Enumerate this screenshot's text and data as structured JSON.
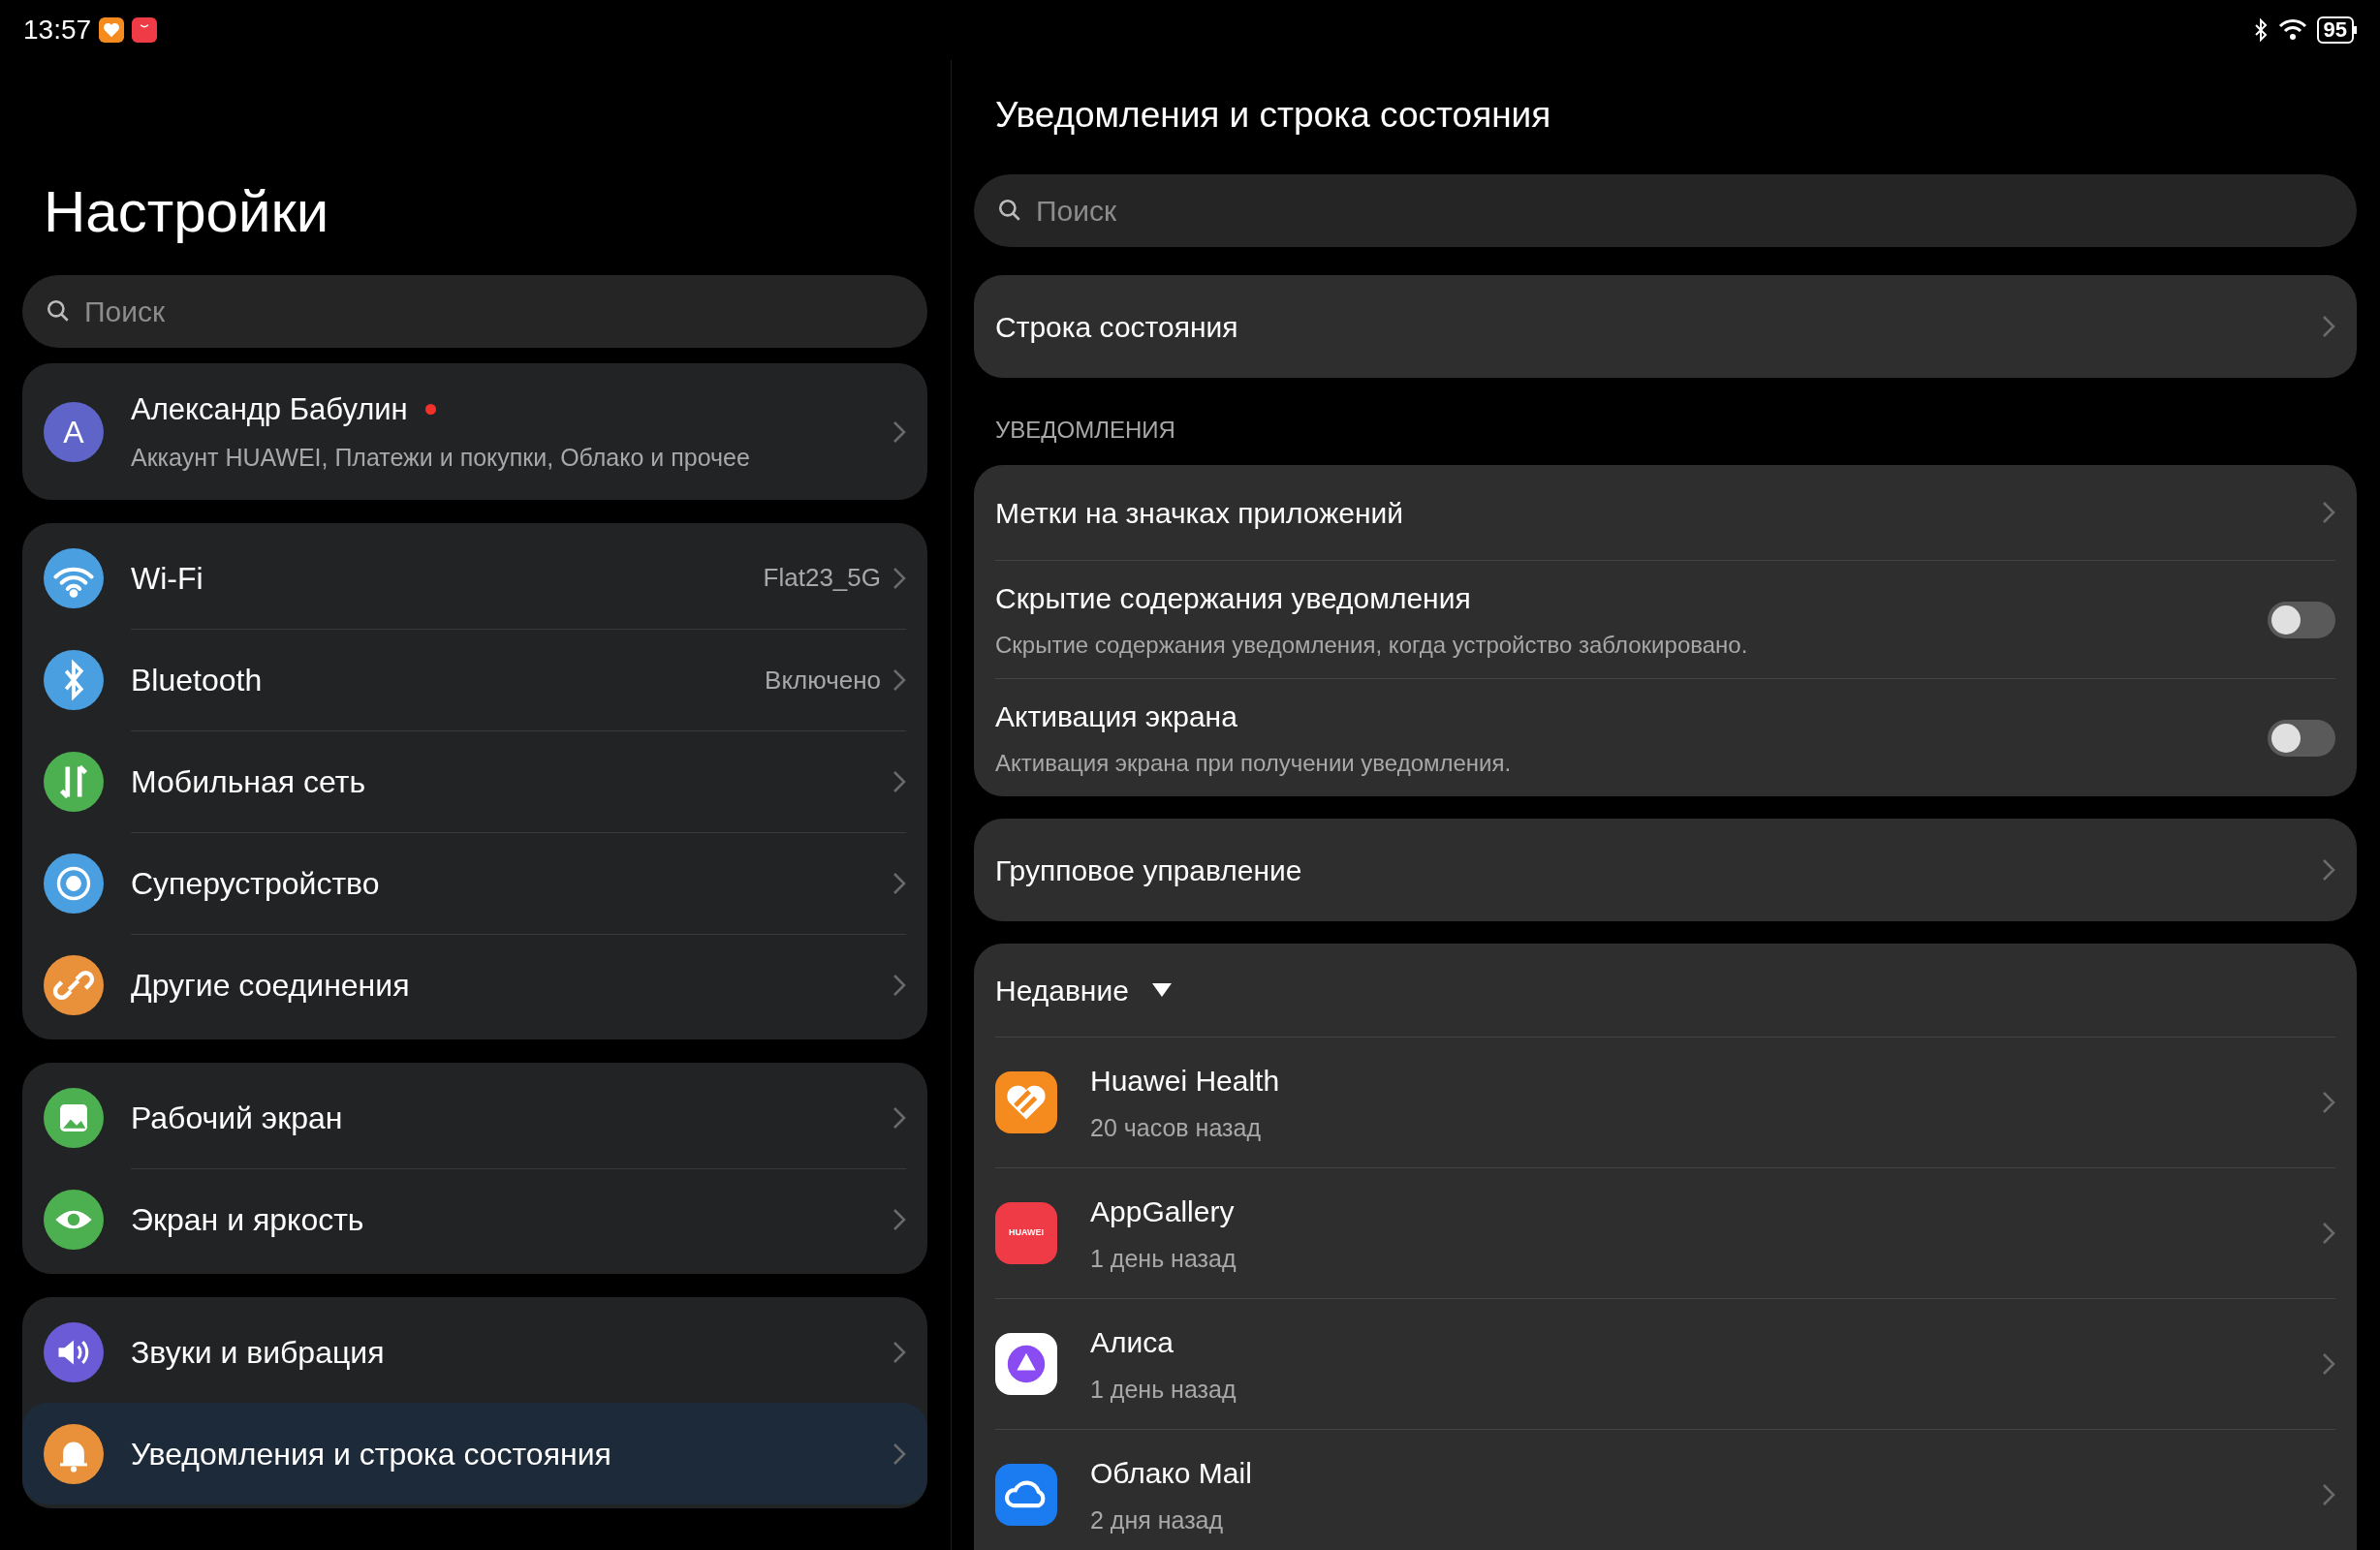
{
  "status_bar": {
    "time": "13:57",
    "battery": "95"
  },
  "sidebar": {
    "title": "Настройки",
    "search": {
      "placeholder": "Поиск"
    },
    "account": {
      "avatar_letter": "А",
      "name": "Александр Бабулин",
      "subtitle": "Аккаунт HUAWEI, Платежи и покупки, Облако и прочее",
      "unread": true
    },
    "groups": [
      {
        "items": [
          {
            "label": "Wi-Fi",
            "value": "Flat23_5G",
            "selected": false
          },
          {
            "label": "Bluetooth",
            "value": "Включено",
            "selected": false
          },
          {
            "label": "Мобильная сеть",
            "selected": false
          },
          {
            "label": "Суперустройство",
            "selected": false
          },
          {
            "label": "Другие соединения",
            "selected": false
          }
        ]
      },
      {
        "items": [
          {
            "label": "Рабочий экран",
            "selected": false
          },
          {
            "label": "Экран и яркость",
            "selected": false
          }
        ]
      },
      {
        "items": [
          {
            "label": "Звуки и вибрация",
            "selected": false
          },
          {
            "label": "Уведомления и строка состояния",
            "selected": true
          }
        ]
      }
    ]
  },
  "content": {
    "title": "Уведомления и строка состояния",
    "search": {
      "placeholder": "Поиск"
    },
    "status_bar_item": {
      "label": "Строка состояния"
    },
    "notifications": {
      "header": "УВЕДОМЛЕНИЯ",
      "items": [
        {
          "kind": "link",
          "label": "Метки на значках приложений"
        },
        {
          "kind": "toggle",
          "label": "Скрытие содержания уведомления",
          "description": "Скрытие содержания уведомления, когда устройство заблокировано.",
          "on": false
        },
        {
          "kind": "toggle",
          "label": "Активация экрана",
          "description": "Активация экрана при получении уведомления.",
          "on": false
        }
      ]
    },
    "group_management": {
      "label": "Групповое управление"
    },
    "recent": {
      "header": "Недавние",
      "apps": [
        {
          "name": "Huawei Health",
          "time": "20 часов назад"
        },
        {
          "name": "AppGallery",
          "icon_text": "HUAWEI",
          "time": "1 день назад"
        },
        {
          "name": "Алиса",
          "time": "1 день назад"
        },
        {
          "name": "Облако Mail",
          "time": "2 дня назад"
        }
      ]
    }
  }
}
